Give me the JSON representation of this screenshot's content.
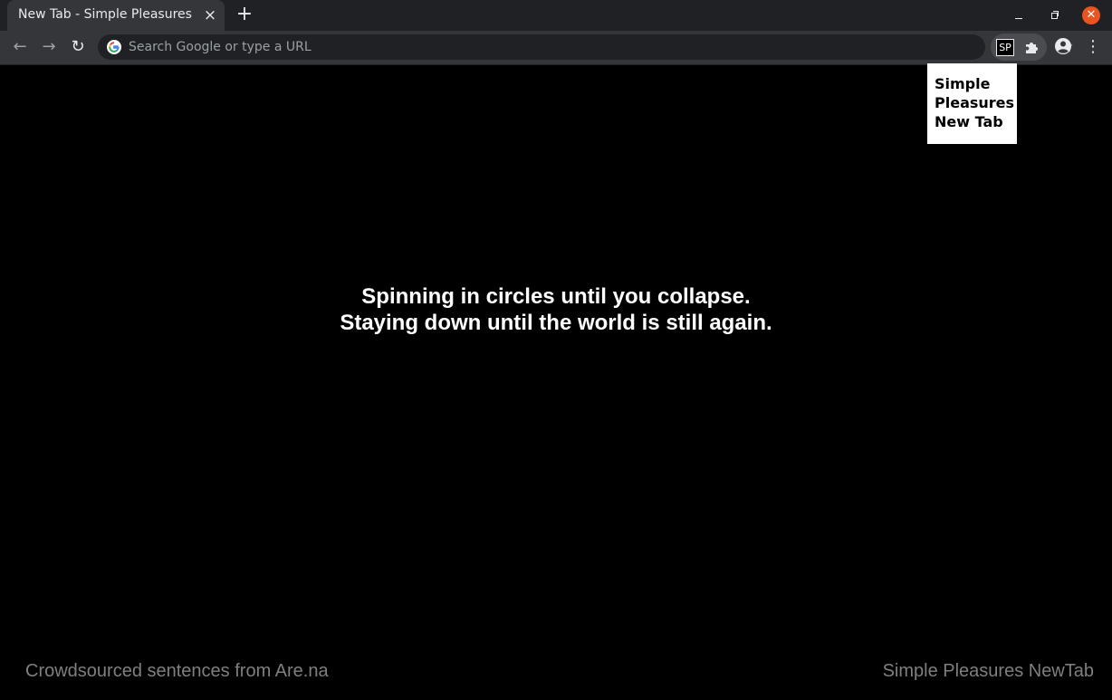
{
  "browser": {
    "tab": {
      "title": "New Tab - Simple Pleasures",
      "close_icon": "close-icon"
    },
    "new_tab_icon": "plus-icon",
    "window_controls": {
      "minimize_icon": "minimize-icon",
      "restore_icon": "restore-icon",
      "close_icon": "close-icon",
      "close_color": "#e95420"
    },
    "toolbar": {
      "back_icon": "arrow-left-icon",
      "forward_icon": "arrow-right-icon",
      "reload_icon": "reload-icon",
      "omnibox_placeholder": "Search Google or type a URL",
      "bookmark_icon": "star-icon",
      "extension_label": "SP",
      "extensions_icon": "puzzle-icon",
      "profile_icon": "account-circle-icon",
      "menu_icon": "more-vert-icon"
    }
  },
  "popup": {
    "title": "Simple Pleasures New Tab"
  },
  "page": {
    "background": "#000000",
    "quote": "Spinning in circles until you collapse. Staying down until the world is still again.",
    "footer_left": "Crowdsourced sentences from Are.na",
    "footer_right": "Simple Pleasures NewTab"
  }
}
